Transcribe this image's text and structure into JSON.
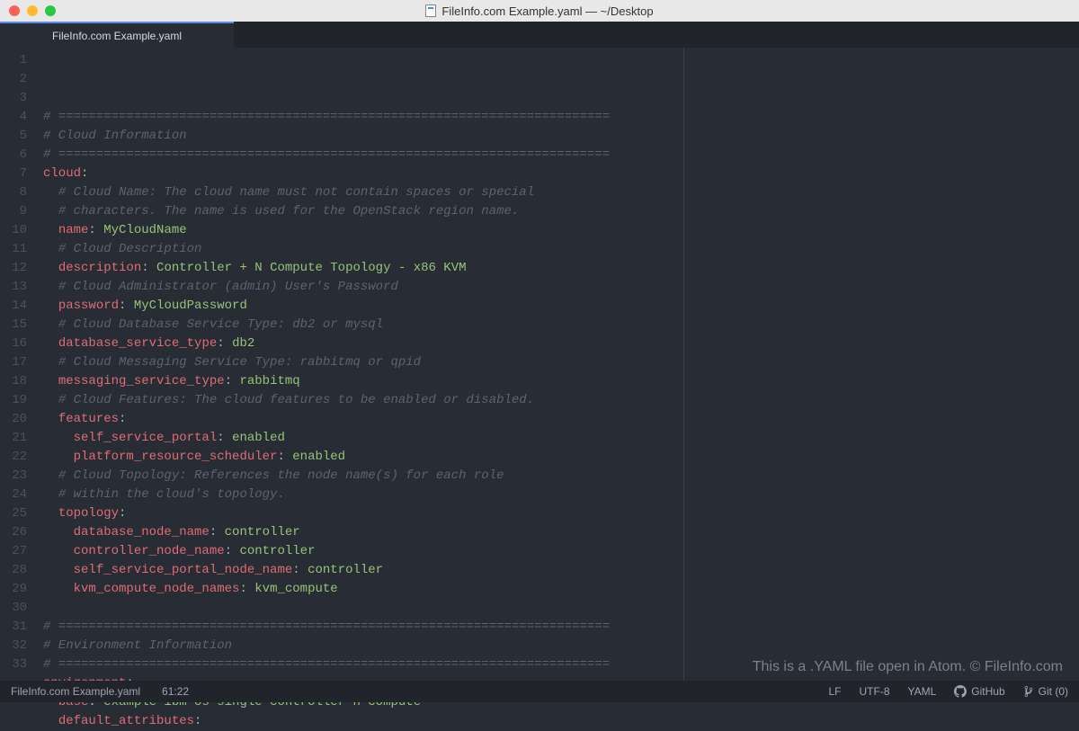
{
  "window": {
    "title": "FileInfo.com Example.yaml — ~/Desktop"
  },
  "tab": {
    "label": "FileInfo.com Example.yaml"
  },
  "code_lines": [
    [
      {
        "t": "# =========================================================================",
        "c": "comment"
      }
    ],
    [
      {
        "t": "# Cloud Information",
        "c": "comment"
      }
    ],
    [
      {
        "t": "# =========================================================================",
        "c": "comment"
      }
    ],
    [
      {
        "t": "cloud",
        "c": "key"
      },
      {
        "t": ":",
        "c": "punc"
      }
    ],
    [
      {
        "t": "  ",
        "c": "plain"
      },
      {
        "t": "# Cloud Name: The cloud name must not contain spaces or special",
        "c": "comment"
      }
    ],
    [
      {
        "t": "  ",
        "c": "plain"
      },
      {
        "t": "# characters. The name is used for the OpenStack region name.",
        "c": "comment"
      }
    ],
    [
      {
        "t": "  ",
        "c": "plain"
      },
      {
        "t": "name",
        "c": "key"
      },
      {
        "t": ": ",
        "c": "punc"
      },
      {
        "t": "MyCloudName",
        "c": "string"
      }
    ],
    [
      {
        "t": "  ",
        "c": "plain"
      },
      {
        "t": "# Cloud Description",
        "c": "comment"
      }
    ],
    [
      {
        "t": "  ",
        "c": "plain"
      },
      {
        "t": "description",
        "c": "key"
      },
      {
        "t": ": ",
        "c": "punc"
      },
      {
        "t": "Controller + N Compute Topology - x86 KVM",
        "c": "string"
      }
    ],
    [
      {
        "t": "  ",
        "c": "plain"
      },
      {
        "t": "# Cloud Administrator (admin) User's Password",
        "c": "comment"
      }
    ],
    [
      {
        "t": "  ",
        "c": "plain"
      },
      {
        "t": "password",
        "c": "key"
      },
      {
        "t": ": ",
        "c": "punc"
      },
      {
        "t": "MyCloudPassword",
        "c": "string"
      }
    ],
    [
      {
        "t": "  ",
        "c": "plain"
      },
      {
        "t": "# Cloud Database Service Type: db2 or mysql",
        "c": "comment"
      }
    ],
    [
      {
        "t": "  ",
        "c": "plain"
      },
      {
        "t": "database_service_type",
        "c": "key"
      },
      {
        "t": ": ",
        "c": "punc"
      },
      {
        "t": "db2",
        "c": "string"
      }
    ],
    [
      {
        "t": "  ",
        "c": "plain"
      },
      {
        "t": "# Cloud Messaging Service Type: rabbitmq or qpid",
        "c": "comment"
      }
    ],
    [
      {
        "t": "  ",
        "c": "plain"
      },
      {
        "t": "messaging_service_type",
        "c": "key"
      },
      {
        "t": ": ",
        "c": "punc"
      },
      {
        "t": "rabbitmq",
        "c": "string"
      }
    ],
    [
      {
        "t": "  ",
        "c": "plain"
      },
      {
        "t": "# Cloud Features: The cloud features to be enabled or disabled.",
        "c": "comment"
      }
    ],
    [
      {
        "t": "  ",
        "c": "plain"
      },
      {
        "t": "features",
        "c": "key"
      },
      {
        "t": ":",
        "c": "punc"
      }
    ],
    [
      {
        "t": "    ",
        "c": "plain"
      },
      {
        "t": "self_service_portal",
        "c": "key"
      },
      {
        "t": ": ",
        "c": "punc"
      },
      {
        "t": "enabled",
        "c": "string"
      }
    ],
    [
      {
        "t": "    ",
        "c": "plain"
      },
      {
        "t": "platform_resource_scheduler",
        "c": "key"
      },
      {
        "t": ": ",
        "c": "punc"
      },
      {
        "t": "enabled",
        "c": "string"
      }
    ],
    [
      {
        "t": "  ",
        "c": "plain"
      },
      {
        "t": "# Cloud Topology: References the node name(s) for each role",
        "c": "comment"
      }
    ],
    [
      {
        "t": "  ",
        "c": "plain"
      },
      {
        "t": "# within the cloud's topology.",
        "c": "comment"
      }
    ],
    [
      {
        "t": "  ",
        "c": "plain"
      },
      {
        "t": "topology",
        "c": "key"
      },
      {
        "t": ":",
        "c": "punc"
      }
    ],
    [
      {
        "t": "    ",
        "c": "plain"
      },
      {
        "t": "database_node_name",
        "c": "key"
      },
      {
        "t": ": ",
        "c": "punc"
      },
      {
        "t": "controller",
        "c": "string"
      }
    ],
    [
      {
        "t": "    ",
        "c": "plain"
      },
      {
        "t": "controller_node_name",
        "c": "key"
      },
      {
        "t": ": ",
        "c": "punc"
      },
      {
        "t": "controller",
        "c": "string"
      }
    ],
    [
      {
        "t": "    ",
        "c": "plain"
      },
      {
        "t": "self_service_portal_node_name",
        "c": "key"
      },
      {
        "t": ": ",
        "c": "punc"
      },
      {
        "t": "controller",
        "c": "string"
      }
    ],
    [
      {
        "t": "    ",
        "c": "plain"
      },
      {
        "t": "kvm_compute_node_names",
        "c": "key"
      },
      {
        "t": ": ",
        "c": "punc"
      },
      {
        "t": "kvm_compute",
        "c": "string"
      }
    ],
    [],
    [
      {
        "t": "# =========================================================================",
        "c": "comment"
      }
    ],
    [
      {
        "t": "# Environment Information",
        "c": "comment"
      }
    ],
    [
      {
        "t": "# =========================================================================",
        "c": "comment"
      }
    ],
    [
      {
        "t": "environment",
        "c": "key"
      },
      {
        "t": ":",
        "c": "punc"
      }
    ],
    [
      {
        "t": "  ",
        "c": "plain"
      },
      {
        "t": "base",
        "c": "key"
      },
      {
        "t": ": ",
        "c": "punc"
      },
      {
        "t": "example-ibm-os-single-controller-n-compute",
        "c": "string"
      }
    ],
    [
      {
        "t": "  ",
        "c": "plain"
      },
      {
        "t": "default_attributes",
        "c": "key"
      },
      {
        "t": ":",
        "c": "punc"
      }
    ]
  ],
  "watermark": "This is a .YAML file open in Atom. © FileInfo.com",
  "statusbar": {
    "filename": "FileInfo.com Example.yaml",
    "cursor": "61:22",
    "line_ending": "LF",
    "encoding": "UTF-8",
    "grammar": "YAML",
    "github": "GitHub",
    "git": "Git (0)"
  }
}
